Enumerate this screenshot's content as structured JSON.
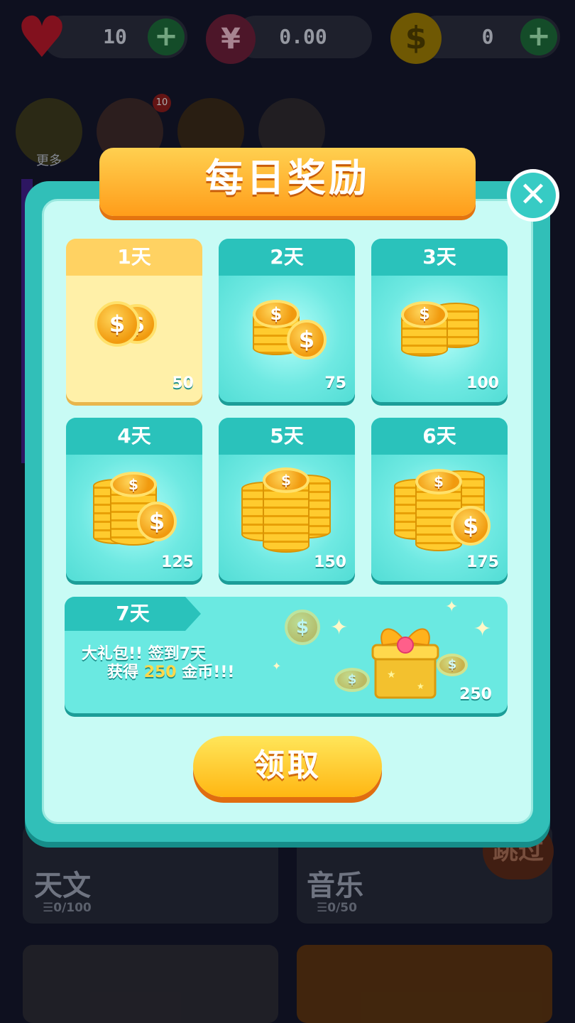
{
  "topbar": {
    "lives_value": "10",
    "cash_value": "0.00",
    "coins_value": "0",
    "plus_symbol": "+"
  },
  "background": {
    "more_label": "更多",
    "shortcut_badge": "10",
    "categories": [
      {
        "title": "天文",
        "progress": "☰0/100"
      },
      {
        "title": "音乐",
        "progress": "☰0/50"
      }
    ],
    "skip_label": "跳过"
  },
  "modal": {
    "title": "每日奖励",
    "close_symbol": "✕",
    "days": [
      {
        "label": "1天",
        "amount": "50"
      },
      {
        "label": "2天",
        "amount": "75"
      },
      {
        "label": "3天",
        "amount": "100"
      },
      {
        "label": "4天",
        "amount": "125"
      },
      {
        "label": "5天",
        "amount": "150"
      },
      {
        "label": "6天",
        "amount": "175"
      }
    ],
    "day7": {
      "label": "7天",
      "line1": "大礼包!! 签到7天",
      "line2_prefix": "获得",
      "line2_highlight": "250",
      "line2_suffix": "金币!!!",
      "amount": "250"
    },
    "claim_label": "领取"
  },
  "colors": {
    "modal_border": "#31bfb8",
    "modal_fill": "#c8fbf5",
    "banner": "#ffb020",
    "claim_button": "#ffc522",
    "active_day": "#ffe88a"
  }
}
